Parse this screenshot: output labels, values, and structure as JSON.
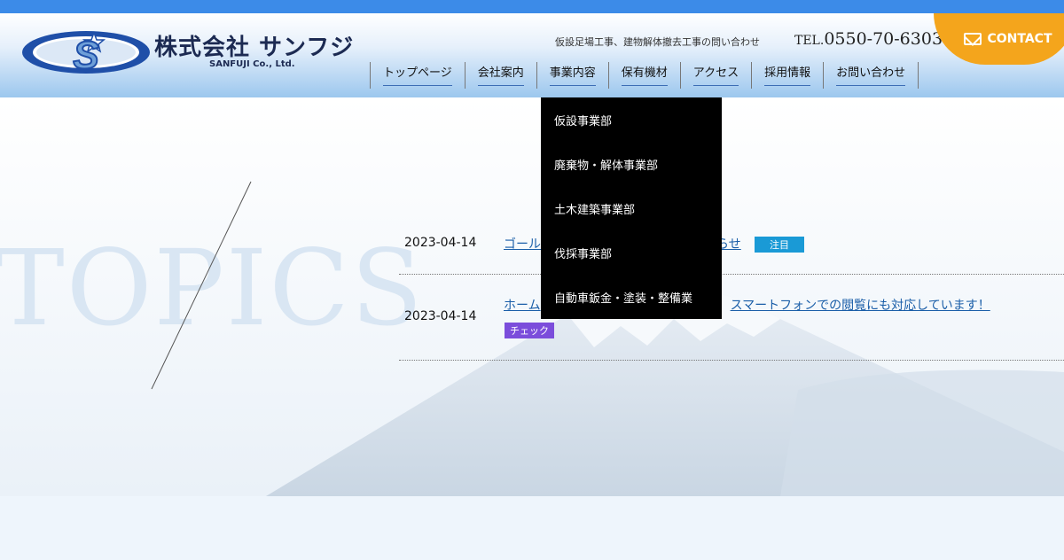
{
  "header": {
    "company_name": "株式会社 サンフジ",
    "company_name_en": "SANFUJI Co., Ltd.",
    "logo_letter": "S",
    "contact_line": "仮設足場工事、建物解体撤去工事の問い合わせ",
    "tel_label": "TEL.",
    "tel_number": "0550-70-6303",
    "contact_button": "CONTACT",
    "contact_icon": "mail-icon"
  },
  "nav": {
    "items": [
      {
        "label": "トップページ"
      },
      {
        "label": "会社案内"
      },
      {
        "label": "事業内容"
      },
      {
        "label": "保有機材"
      },
      {
        "label": "アクセス"
      },
      {
        "label": "採用情報"
      },
      {
        "label": "お問い合わせ"
      }
    ],
    "dropdown": [
      {
        "label": "仮設事業部"
      },
      {
        "label": "廃棄物・解体事業部"
      },
      {
        "label": "土木建築事業部"
      },
      {
        "label": "伐採事業部"
      },
      {
        "label": "自動車鈑金・塗装・整備業"
      }
    ]
  },
  "topics": {
    "heading": "TOPICS",
    "items": [
      {
        "date": "2023-04-14",
        "title_visible_start": "ゴール",
        "title_visible_end": "らせ",
        "badge": "注目",
        "badge_color": "#1a9ad6"
      },
      {
        "date": "2023-04-14",
        "title_visible_start": "ホーム",
        "title_visible_end": "スマートフォンでの閲覧にも対応しています！",
        "badge": "チェック",
        "badge_color": "#7b4ddb"
      }
    ]
  },
  "colors": {
    "topbar": "#3c8be8",
    "contact_button": "#f4a51c",
    "dropdown_bg": "#000000",
    "link": "#1a5ea8"
  }
}
